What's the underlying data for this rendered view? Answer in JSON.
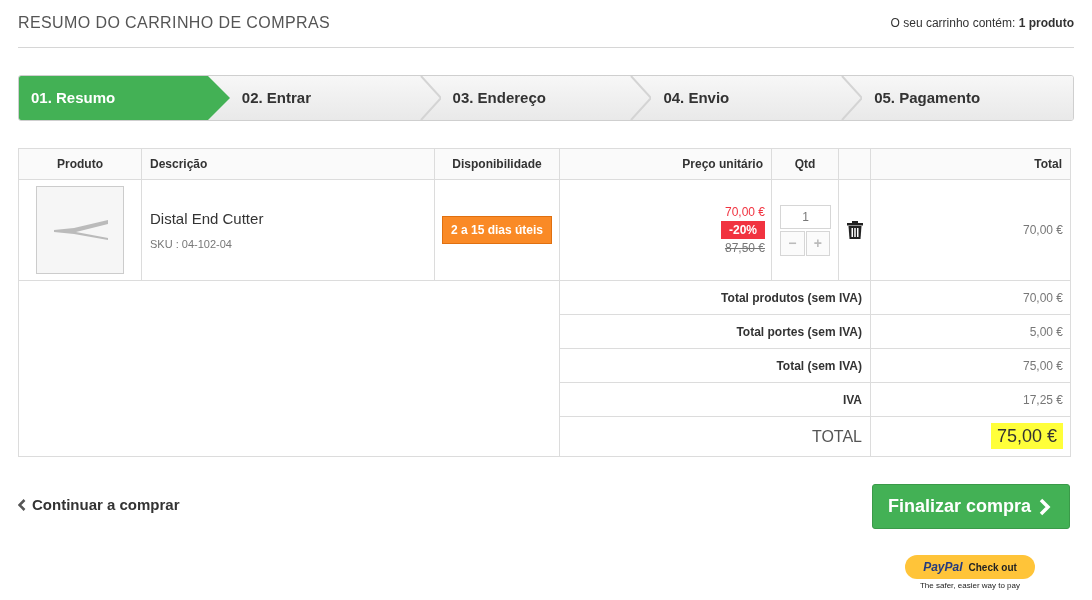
{
  "header": {
    "title": "RESUMO DO CARRINHO DE COMPRAS",
    "cart_label": "O seu carrinho contém:",
    "cart_count": "1 produto"
  },
  "steps": [
    {
      "label": "01. Resumo",
      "selected": true
    },
    {
      "label": "02. Entrar",
      "selected": false
    },
    {
      "label": "03. Endereço",
      "selected": false
    },
    {
      "label": "04. Envio",
      "selected": false
    },
    {
      "label": "05. Pagamento",
      "selected": false
    }
  ],
  "table": {
    "columns": [
      "Produto",
      "Descrição",
      "Disponibilidade",
      "Preço unitário",
      "Qtd",
      "Total"
    ],
    "rows": [
      {
        "name": "Distal End Cutter",
        "sku": "SKU : 04-102-04",
        "availability": "2 a 15 dias úteis",
        "price": "70,00 €",
        "discount": "-20%",
        "old_price": "87,50 €",
        "quantity": "1",
        "minus": "−",
        "plus": "+",
        "total": "70,00 €"
      }
    ],
    "summary": [
      {
        "label": "Total produtos (sem IVA)",
        "value": "70,00 €",
        "kind": "normal"
      },
      {
        "label": "Total portes (sem IVA)",
        "value": "5,00 €",
        "kind": "normal"
      },
      {
        "label": "Total (sem IVA)",
        "value": "75,00 €",
        "kind": "normal"
      },
      {
        "label": "IVA",
        "value": "17,25 €",
        "kind": "normal"
      },
      {
        "label": "TOTAL",
        "value": "75,00 €",
        "kind": "grand"
      }
    ]
  },
  "actions": {
    "continue": "Continuar a comprar",
    "checkout": "Finalizar compra"
  },
  "paypal": {
    "brand": "PayPal",
    "button": "Check out",
    "tagline": "The safer, easier way to pay"
  }
}
